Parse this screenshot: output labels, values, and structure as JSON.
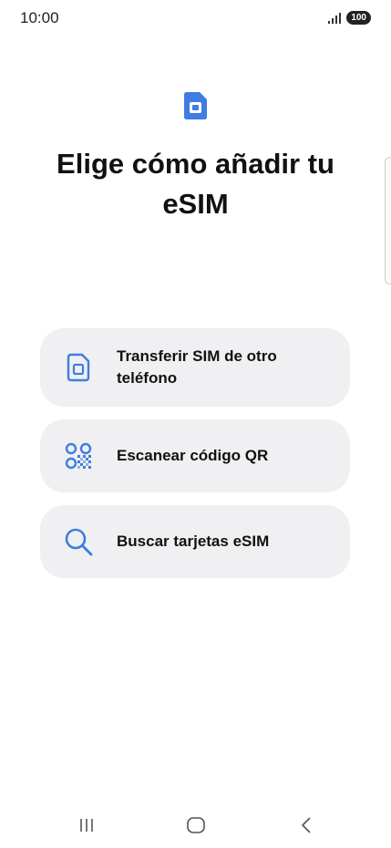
{
  "status_bar": {
    "time": "10:00",
    "battery": "100"
  },
  "header": {
    "icon": "sim-card-icon",
    "title": "Elige cómo añadir tu eSIM"
  },
  "options": [
    {
      "icon": "sim-card-icon",
      "label": "Transferir SIM de otro teléfono"
    },
    {
      "icon": "qr-code-icon",
      "label": "Escanear código QR"
    },
    {
      "icon": "search-icon",
      "label": "Buscar tarjetas eSIM"
    }
  ],
  "nav_bar": {
    "recent": "recent-apps-icon",
    "home": "home-icon",
    "back": "back-icon"
  },
  "colors": {
    "accent": "#3f7de0",
    "card_background": "#f0f0f2",
    "text": "#111111"
  }
}
